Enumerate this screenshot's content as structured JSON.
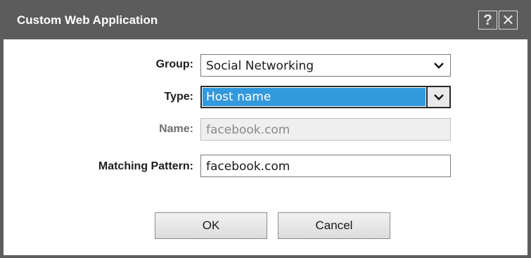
{
  "dialog": {
    "title": "Custom Web Application",
    "help_label": "?",
    "close_label": "✕"
  },
  "form": {
    "group": {
      "label": "Group:",
      "selected": "Social Networking"
    },
    "type": {
      "label": "Type:",
      "selected": "Host name"
    },
    "name": {
      "label": "Name:",
      "value": "facebook.com"
    },
    "pattern": {
      "label": "Matching Pattern:",
      "value": "facebook.com"
    }
  },
  "buttons": {
    "ok": "OK",
    "cancel": "Cancel"
  },
  "colors": {
    "titlebar": "#5c5c5c",
    "selection": "#3399dd"
  },
  "icons": {
    "help": "help-icon",
    "close": "close-icon",
    "dropdown": "chevron-down-icon"
  }
}
